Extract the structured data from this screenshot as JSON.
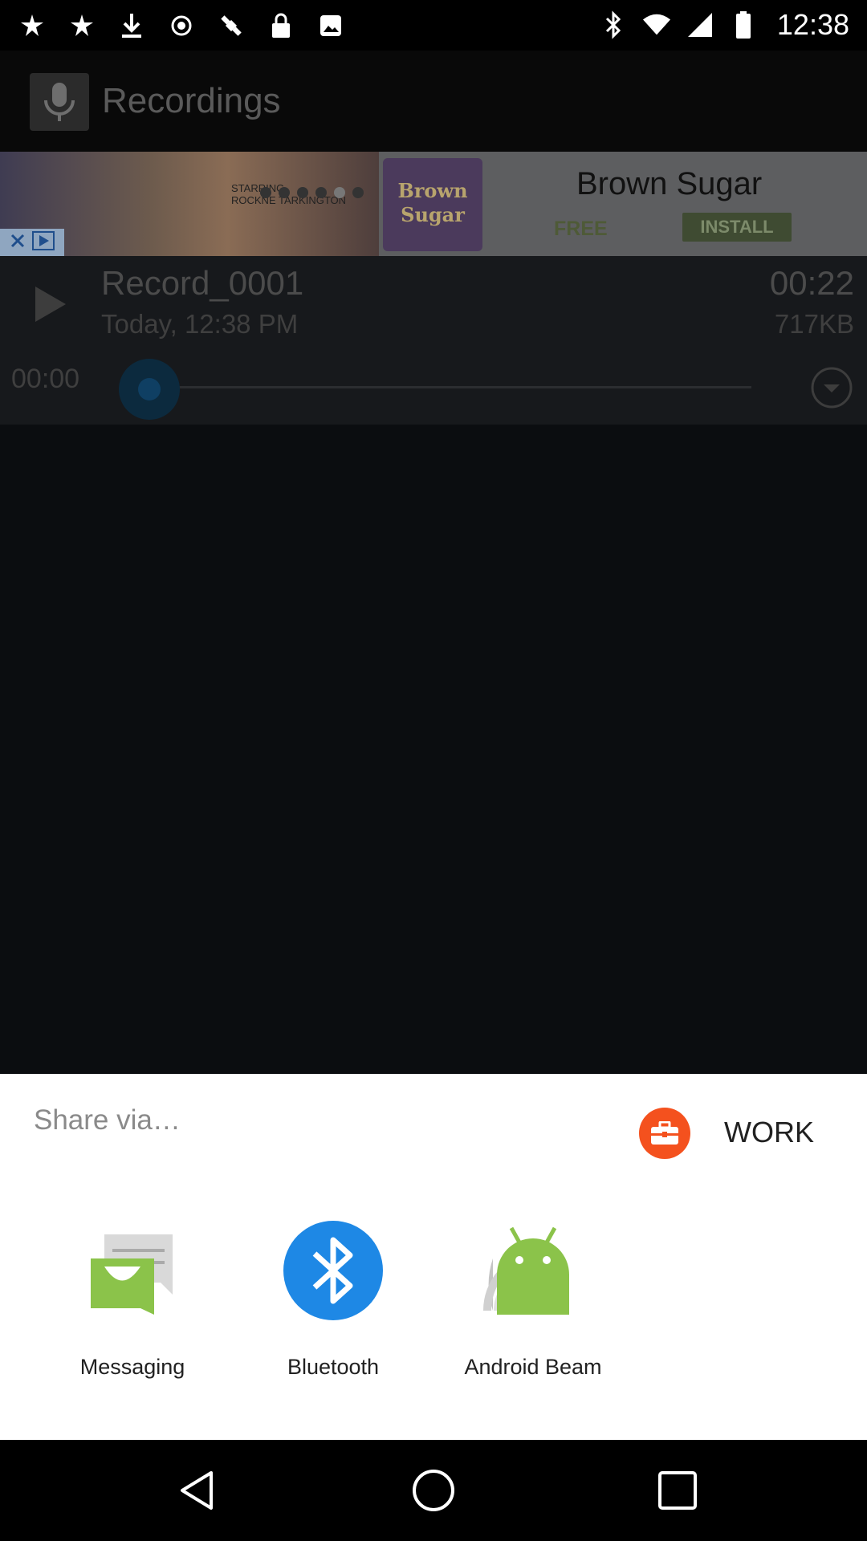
{
  "status_bar": {
    "time": "12:38",
    "left_icons": [
      "gallery-icon",
      "gallery-icon",
      "download-icon",
      "hotspot-icon",
      "satellite-icon",
      "lock-icon",
      "photos-icon"
    ],
    "right_icons": [
      "bluetooth-icon",
      "wifi-icon",
      "signal-icon",
      "battery-icon"
    ]
  },
  "app_bar": {
    "title": "Recordings",
    "icon": "microphone-icon"
  },
  "ad": {
    "starring_text": "STARRING\nROCKNE TARKINGTON",
    "logo_text": "Brown Sugar",
    "name": "Brown Sugar",
    "free": "FREE",
    "install": "INSTALL"
  },
  "recording": {
    "name": "Record_0001",
    "date": "Today, 12:38 PM",
    "duration": "00:22",
    "size": "717KB",
    "position": "00:00",
    "progress": 0.0
  },
  "share": {
    "title": "Share via…",
    "profile_label": "WORK",
    "targets": [
      {
        "label": "Messaging",
        "icon": "messaging-icon"
      },
      {
        "label": "Bluetooth",
        "icon": "bluetooth-icon"
      },
      {
        "label": "Android Beam",
        "icon": "android-beam-icon"
      }
    ]
  },
  "colors": {
    "work_badge": "#f4511e",
    "bluetooth": "#1e88e5",
    "android_green": "#8bc34a",
    "messaging_green": "#8bc34a"
  }
}
